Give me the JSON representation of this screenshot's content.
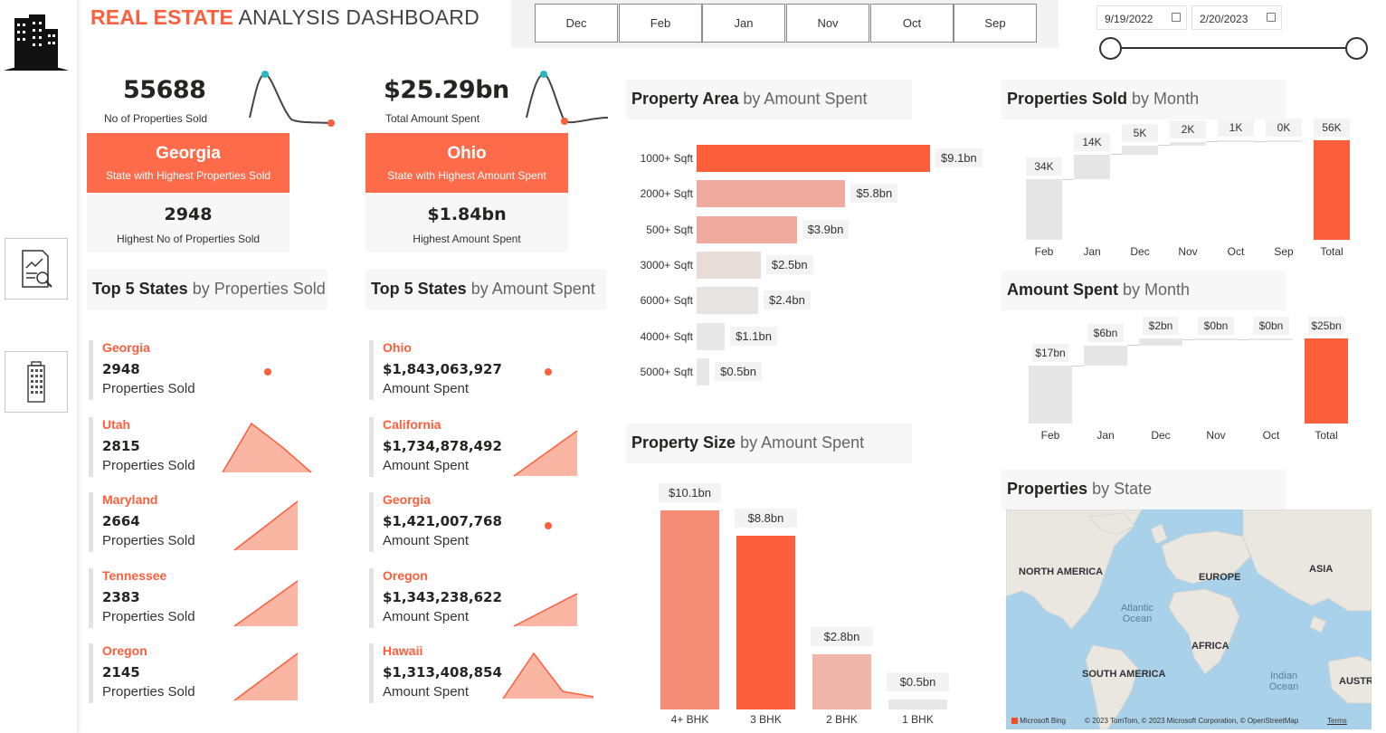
{
  "title": {
    "bold": "REAL ESTATE",
    "light": "ANALYSIS DASHBOARD"
  },
  "month_slicer": [
    "Dec",
    "Feb",
    "Jan",
    "Nov",
    "Oct",
    "Sep"
  ],
  "date_range": {
    "start": "9/19/2022",
    "end": "2/20/2023"
  },
  "nav": [
    {
      "name": "analysis-report-icon"
    },
    {
      "name": "building-icon"
    }
  ],
  "kpi_sold": {
    "value": "55688",
    "caption": "No of Properties Sold",
    "state": "Georgia",
    "state_caption": "State with Highest Properties Sold",
    "top_value": "2948",
    "top_caption": "Highest No of Properties Sold"
  },
  "kpi_amount": {
    "value": "$25.29bn",
    "caption": "Total Amount Spent",
    "state": "Ohio",
    "state_caption": "State with Highest Amount Spent",
    "top_value": "$1.84bn",
    "top_caption": "Highest Amount Spent"
  },
  "top_sold": {
    "title_bold": "Top 5 States",
    "title_light": "by Properties Sold",
    "rows": [
      {
        "state": "Georgia",
        "value": "2948",
        "caption": "Properties Sold"
      },
      {
        "state": "Utah",
        "value": "2815",
        "caption": "Properties Sold"
      },
      {
        "state": "Maryland",
        "value": "2664",
        "caption": "Properties Sold"
      },
      {
        "state": "Tennessee",
        "value": "2383",
        "caption": "Properties Sold"
      },
      {
        "state": "Oregon",
        "value": "2145",
        "caption": "Properties Sold"
      }
    ]
  },
  "top_amount": {
    "title_bold": "Top 5 States",
    "title_light": "by Amount Spent",
    "rows": [
      {
        "state": "Ohio",
        "value": "$1,843,063,927",
        "caption": "Amount Spent"
      },
      {
        "state": "California",
        "value": "$1,734,878,492",
        "caption": "Amount Spent"
      },
      {
        "state": "Georgia",
        "value": "$1,421,007,768",
        "caption": "Amount Spent"
      },
      {
        "state": "Oregon",
        "value": "$1,343,238,622",
        "caption": "Amount Spent"
      },
      {
        "state": "Hawaii",
        "value": "$1,313,408,854",
        "caption": "Amount Spent"
      }
    ]
  },
  "property_area_header": {
    "bold": "Property Area",
    "light": "by Amount Spent"
  },
  "property_size_header": {
    "bold": "Property Size",
    "light": "by Amount Spent"
  },
  "sold_month_header": {
    "bold": "Properties Sold",
    "light": "by Month"
  },
  "amount_month_header": {
    "bold": "Amount Spent",
    "light": "by Month"
  },
  "map_header": {
    "bold": "Properties",
    "light": "by State"
  },
  "map": {
    "continents": [
      "NORTH AMERICA",
      "EUROPE",
      "ASIA",
      "AFRICA",
      "SOUTH AMERICA",
      "AUSTR"
    ],
    "oceans": [
      "Atlantic Ocean",
      "Indian Ocean"
    ],
    "provider": "Microsoft Bing",
    "copyright": "© 2023 TomTom, © 2023 Microsoft Corporation, © OpenStreetMap",
    "terms": "Terms"
  },
  "chart_data": [
    {
      "type": "bar",
      "orientation": "horizontal",
      "categories": [
        "1000+ Sqft",
        "2000+ Sqft",
        "500+ Sqft",
        "3000+ Sqft",
        "6000+ Sqft",
        "4000+ Sqft",
        "5000+ Sqft"
      ],
      "values": [
        9.1,
        5.8,
        3.9,
        2.5,
        2.4,
        1.1,
        0.5
      ],
      "labels": [
        "$9.1bn",
        "$5.8bn",
        "$3.9bn",
        "$2.5bn",
        "$2.4bn",
        "$1.1bn",
        "$0.5bn"
      ],
      "colors": [
        "#fd5e3c",
        "#f1ab9e",
        "#f1ab9e",
        "#e8dcd9",
        "#e8e4e3",
        "#e8e8e8",
        "#e8e8e8"
      ]
    },
    {
      "type": "bar",
      "categories": [
        "4+ BHK",
        "3 BHK",
        "2 BHK",
        "1 BHK"
      ],
      "values": [
        10.1,
        8.8,
        2.8,
        0.5
      ],
      "labels": [
        "$10.1bn",
        "$8.8bn",
        "$2.8bn",
        "$0.5bn"
      ],
      "colors": [
        "#f58d76",
        "#fd5e3c",
        "#efb6a9",
        "#e8e8e8"
      ]
    },
    {
      "type": "waterfall",
      "categories": [
        "Feb",
        "Jan",
        "Dec",
        "Nov",
        "Oct",
        "Sep",
        "Total"
      ],
      "values": [
        34,
        14,
        5,
        2,
        1,
        0,
        56
      ],
      "labels": [
        "34K",
        "14K",
        "5K",
        "2K",
        "1K",
        "0K",
        "56K"
      ],
      "total_color": "#fd5e3c",
      "step_color": "#e6e6e6"
    },
    {
      "type": "waterfall",
      "categories": [
        "Feb",
        "Jan",
        "Dec",
        "Nov",
        "Oct",
        "Total"
      ],
      "values": [
        17,
        6,
        2,
        0,
        0,
        25
      ],
      "labels": [
        "$17bn",
        "$6bn",
        "$2bn",
        "$0bn",
        "$0bn",
        "$25bn"
      ],
      "total_color": "#fd5e3c",
      "step_color": "#e6e6e6"
    }
  ]
}
